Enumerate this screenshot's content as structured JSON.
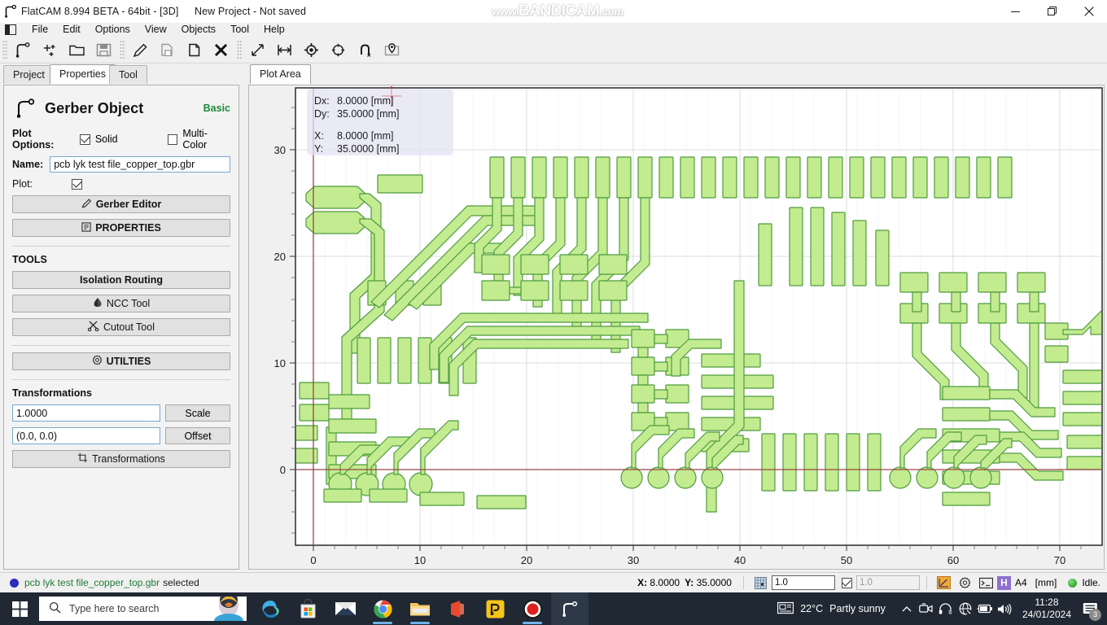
{
  "titlebar": {
    "app_title": "FlatCAM 8.994 BETA - 64bit - [3D]",
    "project_status": "New Project - Not saved",
    "watermark_www": "www.",
    "watermark_main": "BANDICAM",
    "watermark_com": ".com",
    "minimize": "minimize-button",
    "maximize": "restore-button",
    "close": "close-button"
  },
  "menubar": {
    "items": [
      {
        "label": "File"
      },
      {
        "label": "Edit"
      },
      {
        "label": "Options"
      },
      {
        "label": "View"
      },
      {
        "label": "Objects"
      },
      {
        "label": "Tool"
      },
      {
        "label": "Help"
      }
    ]
  },
  "toolbar": {
    "buttons": [
      {
        "name": "new-gerber-icon"
      },
      {
        "name": "new-geometry-icon"
      },
      {
        "name": "open-folder-icon"
      },
      {
        "name": "save-icon"
      },
      {
        "name": "edit-pencil-icon"
      },
      {
        "name": "save-object-icon"
      },
      {
        "name": "copy-object-icon"
      },
      {
        "name": "delete-object-icon"
      },
      {
        "name": "measure-distance-icon"
      },
      {
        "name": "measure-min-distance-icon"
      },
      {
        "name": "set-origin-icon"
      },
      {
        "name": "jump-to-location-icon"
      },
      {
        "name": "snap-magnet-icon"
      },
      {
        "name": "locate-in-object-icon"
      }
    ]
  },
  "tabs": {
    "left": [
      {
        "label": "Project",
        "active": false
      },
      {
        "label": "Properties",
        "active": true
      },
      {
        "label": "Tool",
        "active": false
      }
    ],
    "right": [
      {
        "label": "Plot Area",
        "active": true
      }
    ]
  },
  "properties_panel": {
    "title": "Gerber Object",
    "level_badge": "Basic",
    "plot_options_label": "Plot Options:",
    "solid_label": "Solid",
    "solid_checked": true,
    "multicolor_label": "Multi-Color",
    "multicolor_checked": false,
    "name_label": "Name:",
    "name_value": "pcb lyk test file_copper_top.gbr",
    "plot_label": "Plot:",
    "plot_checked": true,
    "gerber_editor_button": "Gerber Editor",
    "properties_button": "PROPERTIES",
    "tools_heading": "TOOLS",
    "isolation_routing_button": "Isolation Routing",
    "ncc_tool_button": "NCC Tool",
    "cutout_tool_button": "Cutout Tool",
    "utilities_button": "UTILTIES",
    "transformations_heading": "Transformations",
    "scale_value": "1.0000",
    "scale_button": "Scale",
    "offset_value": "(0.0, 0.0)",
    "offset_button": "Offset",
    "transformations_button": "Transformations"
  },
  "plot": {
    "tooltip": {
      "dx_label": "Dx:",
      "dx_value": "8.0000 [mm]",
      "dy_label": "Dy:",
      "dy_value": "35.0000 [mm]",
      "x_label": "X:",
      "x_value": "8.0000 [mm]",
      "y_label": "Y:",
      "y_value": "35.0000 [mm]"
    },
    "x_ticks": [
      "0",
      "10",
      "20",
      "30",
      "40",
      "50",
      "60",
      "70"
    ],
    "y_ticks": [
      "0",
      "10",
      "20",
      "30"
    ],
    "trace_fill": "#c3eb8f",
    "trace_stroke": "#4f9b3f",
    "axis_line_color": "#9a4444"
  },
  "statusbar": {
    "selected_file": "pcb lyk test file_copper_top.gbr",
    "selected_suffix": "selected",
    "x_label": "X:",
    "x_value": "8.0000",
    "y_label": "Y:",
    "y_value": "35.0000",
    "snap_value": "1.0",
    "snap_secondary_value": "1.0",
    "snap_secondary_checked": true,
    "axis_icon": "axis-toggle-icon",
    "workspace_icon": "gear-icon",
    "shell_icon": "terminal-icon",
    "hud_badge": "H",
    "paper_size": "A4",
    "units": "[mm]",
    "state": "Idle."
  },
  "taskbar": {
    "start_button": "windows-start-button",
    "search_placeholder": "Type here to search",
    "apps": [
      {
        "name": "edge-icon"
      },
      {
        "name": "microsoft-store-icon"
      },
      {
        "name": "mail-icon"
      },
      {
        "name": "chrome-icon"
      },
      {
        "name": "file-explorer-icon"
      },
      {
        "name": "office-icon"
      },
      {
        "name": "yellow-app-icon"
      },
      {
        "name": "bandicam-icon"
      },
      {
        "name": "flatcam-icon"
      }
    ],
    "weather_temp": "22°C",
    "weather_desc": "Partly sunny",
    "tray_icons": [
      "chevron-up-icon",
      "meet-now-icon",
      "headset-icon",
      "network-icon",
      "battery-icon",
      "volume-icon"
    ],
    "clock_time": "11:28",
    "clock_date": "24/01/2024",
    "notification_count": "3"
  }
}
